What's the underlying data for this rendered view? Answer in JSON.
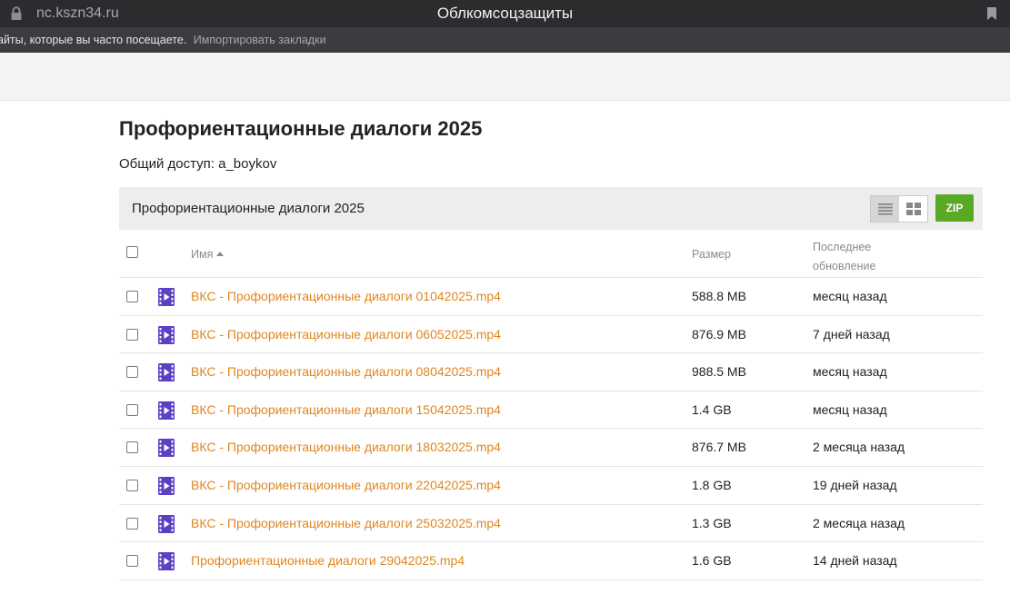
{
  "browser": {
    "url": "nc.kszn34.ru",
    "window_title": "Облкомсоцзащиты",
    "bookmarks_hint": "айты, которые вы часто посещаете.",
    "bookmarks_import": "Импортировать закладки"
  },
  "page": {
    "title": "Профориентационные диалоги 2025",
    "shared_by": "Общий доступ: a_boykov"
  },
  "toolbar": {
    "breadcrumb": "Профориентационные диалоги 2025",
    "zip_label": "ZIP"
  },
  "table": {
    "headers": {
      "name": "Имя",
      "size": "Размер",
      "updated": "Последнее обновление"
    },
    "rows": [
      {
        "name": "ВКС - Профориентационные диалоги 01042025.mp4",
        "size": "588.8 MB",
        "updated": "месяц назад"
      },
      {
        "name": "ВКС - Профориентационные диалоги 06052025.mp4",
        "size": "876.9 MB",
        "updated": "7 дней назад"
      },
      {
        "name": "ВКС - Профориентационные диалоги 08042025.mp4",
        "size": "988.5 MB",
        "updated": "месяц назад"
      },
      {
        "name": "ВКС - Профориентационные диалоги 15042025.mp4",
        "size": "1.4 GB",
        "updated": "месяц назад"
      },
      {
        "name": "ВКС - Профориентационные диалоги 18032025.mp4",
        "size": "876.7 MB",
        "updated": "2 месяца назад"
      },
      {
        "name": "ВКС - Профориентационные диалоги 22042025.mp4",
        "size": "1.8 GB",
        "updated": "19 дней назад"
      },
      {
        "name": "ВКС - Профориентационные диалоги 25032025.mp4",
        "size": "1.3 GB",
        "updated": "2 месяца назад"
      },
      {
        "name": "Профориентационные диалоги 29042025.mp4",
        "size": "1.6 GB",
        "updated": "14 дней назад"
      }
    ]
  },
  "icons": {
    "file_row": "video-file-icon",
    "lock": "lock-icon",
    "bookmark": "bookmark-icon",
    "list_view": "list-view-icon",
    "grid_view": "grid-view-icon"
  },
  "colors": {
    "link": "#e0861f",
    "zip_button": "#5aa924",
    "video_icon": "#5b3fc4"
  }
}
